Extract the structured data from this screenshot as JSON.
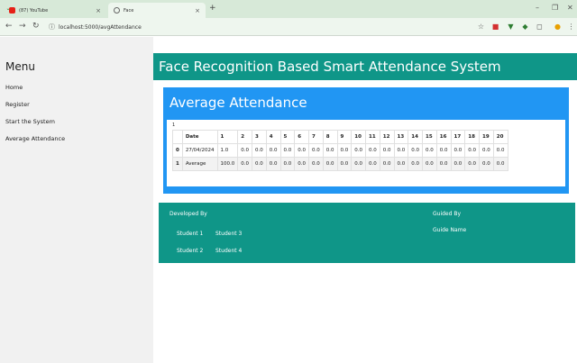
{
  "browser": {
    "tabs": [
      {
        "title": "(87) YouTube",
        "active": false
      },
      {
        "title": "Face",
        "active": true
      }
    ],
    "url": "localhost:5000/avgAttendance"
  },
  "colors": {
    "teal": "#0f9688",
    "blue": "#2196f3",
    "sidebar": "#f1f1f1"
  },
  "sidebar": {
    "title": "Menu",
    "items": [
      "Home",
      "Register",
      "Start the System",
      "Average Attendance"
    ]
  },
  "header": {
    "title": "Face Recognition Based Smart Attendance System"
  },
  "card": {
    "title": "Average Attendance",
    "index_label": "1",
    "columns": [
      "",
      "Date",
      "1",
      "2",
      "3",
      "4",
      "5",
      "6",
      "7",
      "8",
      "9",
      "10",
      "11",
      "12",
      "13",
      "14",
      "15",
      "16",
      "17",
      "18",
      "19",
      "20"
    ],
    "rows": [
      [
        "0",
        "27/04/2024",
        "1.0",
        "0.0",
        "0.0",
        "0.0",
        "0.0",
        "0.0",
        "0.0",
        "0.0",
        "0.0",
        "0.0",
        "0.0",
        "0.0",
        "0.0",
        "0.0",
        "0.0",
        "0.0",
        "0.0",
        "0.0",
        "0.0",
        "0.0"
      ],
      [
        "1",
        "Average",
        "100.0",
        "0.0",
        "0.0",
        "0.0",
        "0.0",
        "0.0",
        "0.0",
        "0.0",
        "0.0",
        "0.0",
        "0.0",
        "0.0",
        "0.0",
        "0.0",
        "0.0",
        "0.0",
        "0.0",
        "0.0",
        "0.0",
        "0.0"
      ]
    ]
  },
  "footer": {
    "developed_by": "Developed By",
    "students": [
      "Student 1",
      "Student 3",
      "Student 2",
      "Student 4"
    ],
    "guided_by": "Guided By",
    "guide_name": "Guide Name"
  }
}
